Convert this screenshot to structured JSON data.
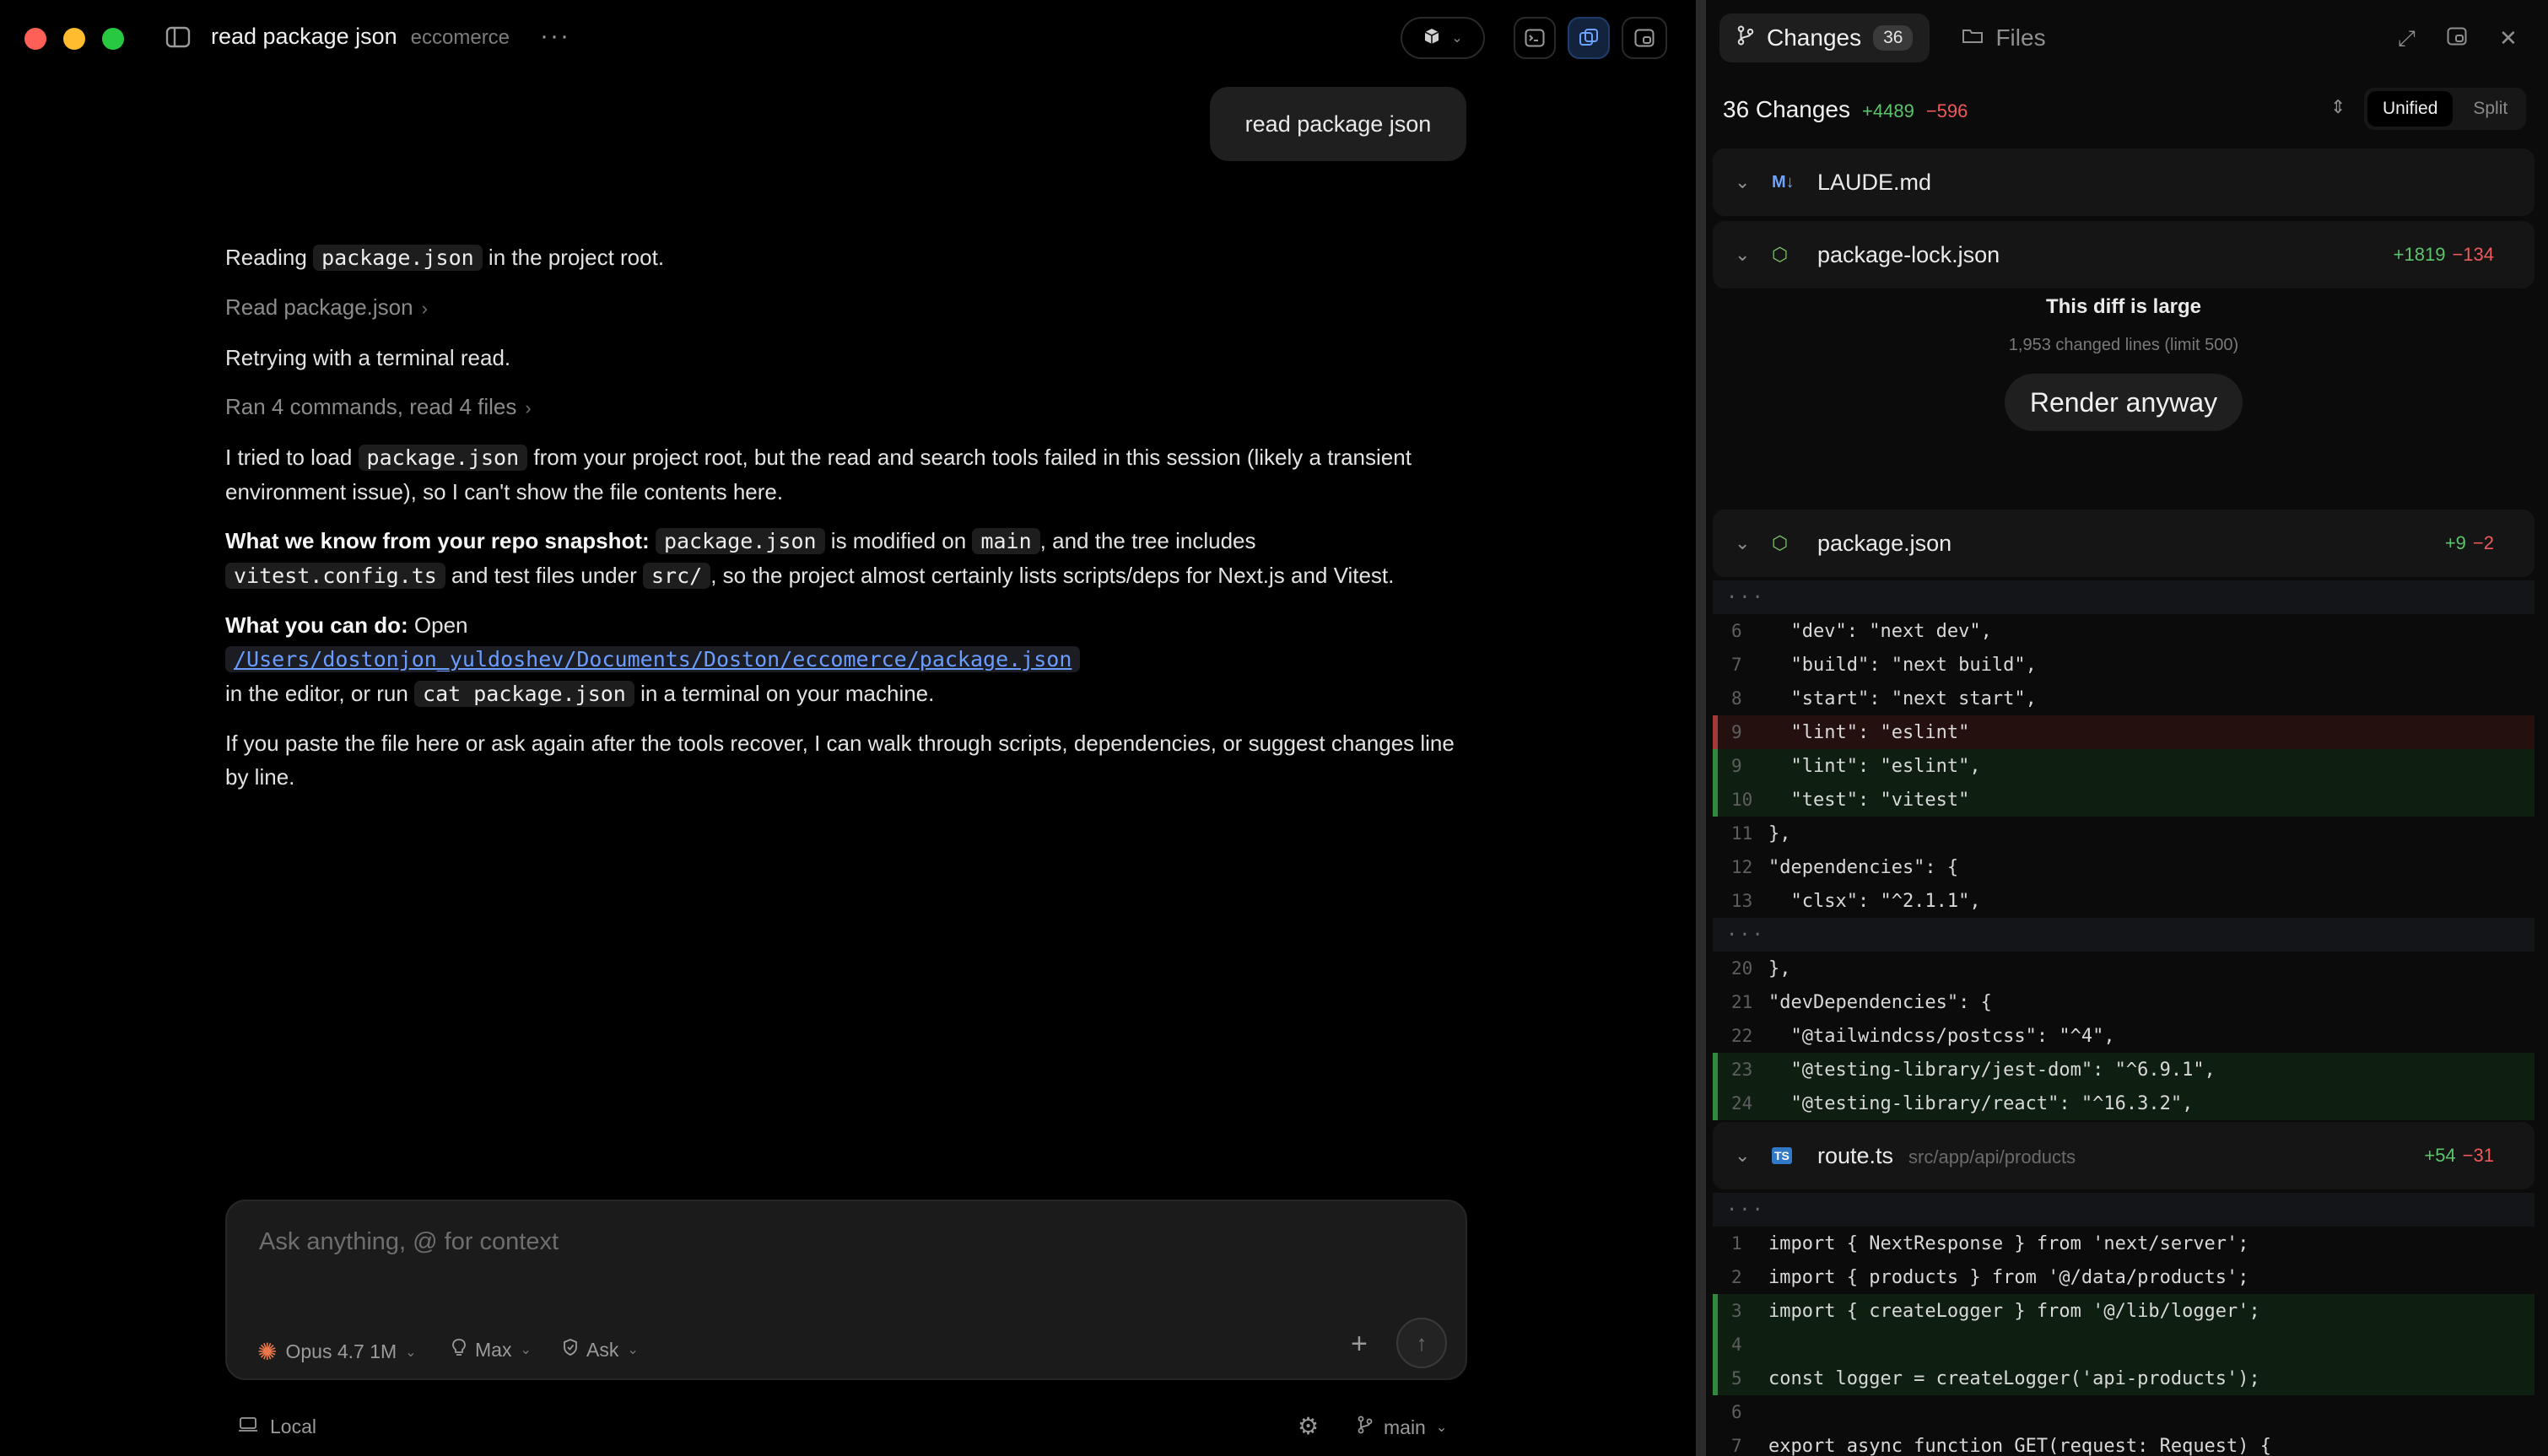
{
  "window": {
    "title": "read package json",
    "project": "eccomerce"
  },
  "user_message": "read package json",
  "conversation": {
    "p1": {
      "pre": "Reading ",
      "code": "package.json",
      "post": " in the project root."
    },
    "tool1": "Read package.json",
    "p2": "Retrying with a terminal read.",
    "tool2": "Ran 4 commands, read 4 files",
    "p3": {
      "pre": "I tried to load ",
      "code": "package.json",
      "post": " from your project root, but the read and search tools failed in this session (likely a transient environment issue), so I can't show the file contents here."
    },
    "p4": {
      "bold": "What we know from your repo snapshot:",
      "code1": "package.json",
      "mid1": " is modified on ",
      "code2": "main",
      "mid2": ", and the tree includes ",
      "code3": "vitest.config.ts",
      "mid3": " and test files under ",
      "code4": "src/",
      "post": ", so the project almost certainly lists scripts/deps for Next.js and Vitest."
    },
    "p5": {
      "bold": "What you can do:",
      "pre": " Open",
      "link": "/Users/dostonjon_yuldoshev/Documents/Doston/eccomerce/package.json",
      "mid": "in the editor, or run ",
      "code": "cat package.json",
      "post": " in a terminal on your machine."
    },
    "p6": "If you paste the file here or ask again after the tools recover, I can walk through scripts, dependencies, or suggest changes line by line."
  },
  "composer": {
    "placeholder": "Ask anything, @ for context",
    "model": "Opus 4.7 1M",
    "effort": "Max",
    "mode": "Ask"
  },
  "footer": {
    "location": "Local",
    "branch": "main"
  },
  "panel": {
    "tab_changes": "Changes",
    "tab_changes_count": "36",
    "tab_files": "Files",
    "summary": "36 Changes",
    "summary_add": "+4489",
    "summary_del": "−596",
    "view_unified": "Unified",
    "view_split": "Split",
    "files": [
      {
        "name": "LAUDE.md",
        "icon": "M↓",
        "add": "",
        "del": ""
      },
      {
        "name": "package-lock.json",
        "icon": "⬡",
        "add": "+1819",
        "del": "−134"
      },
      {
        "name": "package.json",
        "icon": "⬡",
        "add": "+9",
        "del": "−2"
      },
      {
        "name": "route.ts",
        "path": "src/app/api/products",
        "icon": "TS",
        "add": "+54",
        "del": "−31"
      }
    ],
    "large_diff": {
      "title": "This diff is large",
      "subtitle": "1,953 changed lines (limit 500)",
      "button": "Render anyway"
    },
    "pkg_diff": [
      {
        "kind": "hunk",
        "ln": "",
        "text": "···"
      },
      {
        "kind": "ctx",
        "ln": "6",
        "text": "  \"dev\": \"next dev\","
      },
      {
        "kind": "ctx",
        "ln": "7",
        "text": "  \"build\": \"next build\","
      },
      {
        "kind": "ctx",
        "ln": "8",
        "text": "  \"start\": \"next start\","
      },
      {
        "kind": "removed",
        "ln": "9",
        "text": "  \"lint\": \"eslint\""
      },
      {
        "kind": "added",
        "ln": "9",
        "text": "  \"lint\": \"eslint\","
      },
      {
        "kind": "added",
        "ln": "10",
        "text": "  \"test\": \"vitest\""
      },
      {
        "kind": "ctx",
        "ln": "11",
        "text": "},"
      },
      {
        "kind": "ctx",
        "ln": "12",
        "text": "\"dependencies\": {"
      },
      {
        "kind": "ctx",
        "ln": "13",
        "text": "  \"clsx\": \"^2.1.1\","
      },
      {
        "kind": "hunk",
        "ln": "",
        "text": "···"
      },
      {
        "kind": "ctx",
        "ln": "20",
        "text": "},"
      },
      {
        "kind": "ctx",
        "ln": "21",
        "text": "\"devDependencies\": {"
      },
      {
        "kind": "ctx",
        "ln": "22",
        "text": "  \"@tailwindcss/postcss\": \"^4\","
      },
      {
        "kind": "added",
        "ln": "23",
        "text": "  \"@testing-library/jest-dom\": \"^6.9.1\","
      },
      {
        "kind": "added",
        "ln": "24",
        "text": "  \"@testing-library/react\": \"^16.3.2\","
      }
    ],
    "route_diff": [
      {
        "kind": "hunk",
        "ln": "",
        "text": "···"
      },
      {
        "kind": "ctx",
        "ln": "1",
        "text": "import { NextResponse } from 'next/server';"
      },
      {
        "kind": "ctx",
        "ln": "2",
        "text": "import { products } from '@/data/products';"
      },
      {
        "kind": "added",
        "ln": "3",
        "text": "import { createLogger } from '@/lib/logger';"
      },
      {
        "kind": "added",
        "ln": "4",
        "text": ""
      },
      {
        "kind": "added",
        "ln": "5",
        "text": "const logger = createLogger('api-products');"
      },
      {
        "kind": "ctx",
        "ln": "6",
        "text": ""
      },
      {
        "kind": "ctx",
        "ln": "7",
        "text": "export async function GET(request: Request) {"
      }
    ]
  },
  "colors": {
    "accent_blue": "#6ea2ff",
    "add_green": "#5cc46b",
    "del_red": "#ef5a5a",
    "spark_orange": "#e8774b"
  }
}
